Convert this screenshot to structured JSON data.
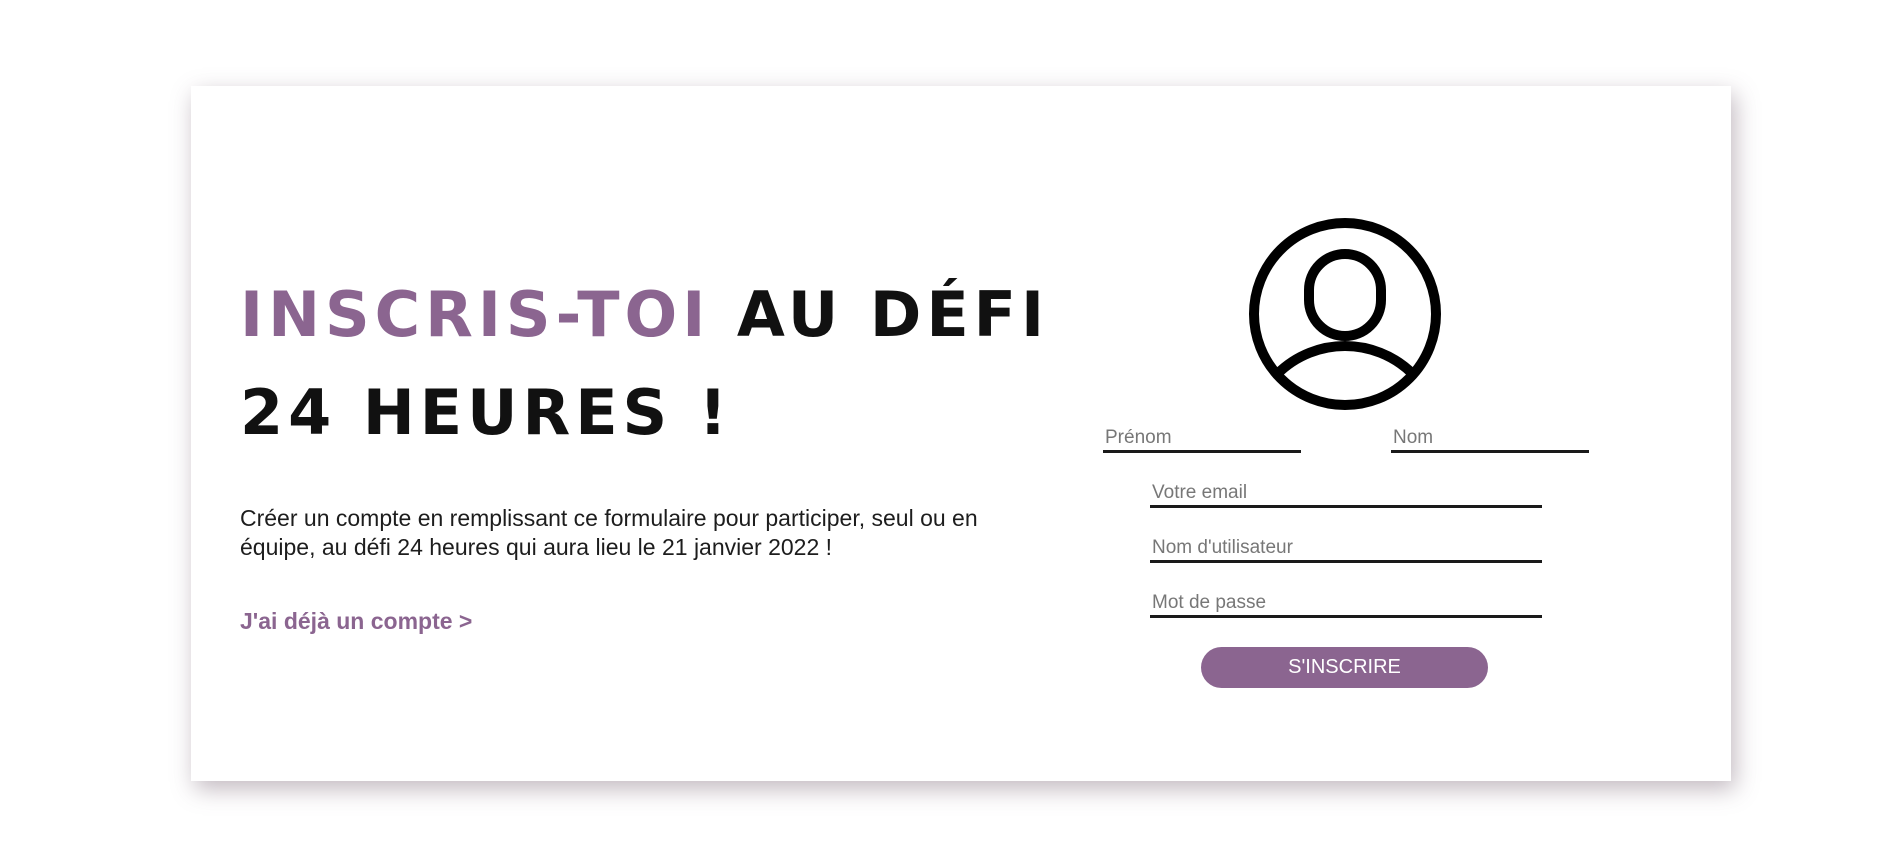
{
  "colors": {
    "accent": "#8b6590",
    "text": "#1d1d1d",
    "underline": "#1a1a1a"
  },
  "hero": {
    "title_accent": "INSCRIS-TOI",
    "title_line1_rest": " AU DÉFI",
    "title_line2": "24 HEURES !",
    "description": "Créer un compte en remplissant ce formulaire pour participer, seul ou en équipe, au défi 24 heures qui aura lieu le 21 janvier 2022 !",
    "login_link": "J'ai déjà un compte >"
  },
  "form": {
    "avatar_icon": "user-circle-icon",
    "first_name": {
      "placeholder": "Prénom",
      "value": ""
    },
    "last_name": {
      "placeholder": "Nom",
      "value": ""
    },
    "email": {
      "placeholder": "Votre email",
      "value": ""
    },
    "username": {
      "placeholder": "Nom d'utilisateur",
      "value": ""
    },
    "password": {
      "placeholder": "Mot de passe",
      "value": ""
    },
    "submit_label": "S'INSCRIRE"
  }
}
